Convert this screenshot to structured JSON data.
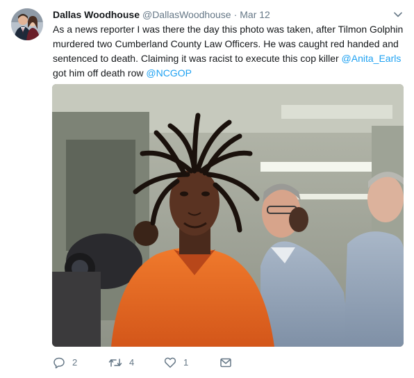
{
  "tweet": {
    "author": {
      "name": "Dallas Woodhouse",
      "handle": "@DallasWoodhouse",
      "avatar_icon": "profile-photo"
    },
    "separator": "·",
    "date": "Mar 12",
    "text_lines": [
      "As a news reporter I was there the day this photo was taken, after Tilmon Golphin",
      "murdered  two Cumberland County Law Officers. He was caught red handed and",
      "sentenced to death. Claiming it was racist to execute this cop killer "
    ],
    "mention_1": "@Anita_Earls",
    "line4_text": "got him off death row ",
    "mention_2": "@NCGOP",
    "media": {
      "type": "photo"
    },
    "actions": {
      "reply_count": "2",
      "retweet_count": "4",
      "like_count": "1",
      "reply_icon": "reply-icon",
      "retweet_icon": "retweet-icon",
      "like_icon": "heart-icon",
      "dm_icon": "envelope-icon"
    },
    "colors": {
      "link": "#1da1f2",
      "secondary_text": "#657786",
      "primary_text": "#14171a"
    }
  }
}
